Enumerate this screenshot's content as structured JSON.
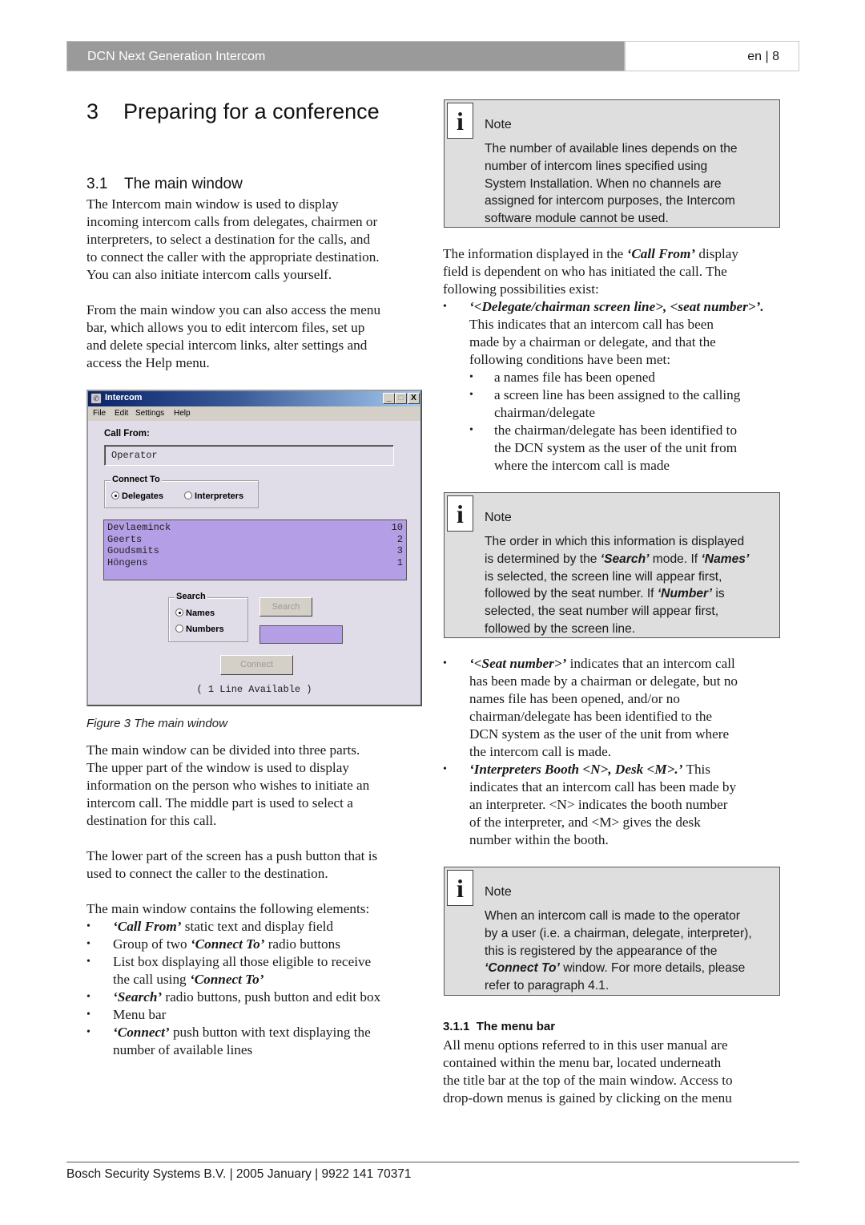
{
  "header": {
    "title": "DCN Next Generation Intercom",
    "page_ref": "en | 8"
  },
  "chapter": {
    "number": "3",
    "title": "Preparing for a conference"
  },
  "section": {
    "number": "3.1",
    "title": "The main window"
  },
  "left": {
    "intro_lines": [
      "The Intercom main window is used to display",
      "incoming intercom calls from delegates, chairmen or",
      "interpreters, to select a destination for the calls, and",
      "to connect the caller with the appropriate destination.",
      "You can also initiate intercom calls yourself."
    ],
    "menu_lines": [
      "From the main window you can also access the menu",
      "bar, which allows you to edit intercom files, set up",
      "and delete special intercom links, alter settings and",
      "access the Help menu."
    ],
    "figure_caption": "Figure 3 The main window",
    "parts_lines": [
      "The main window can be divided into three parts.",
      "The upper part of the window is used to display",
      "information on the person who wishes to initiate an",
      "intercom call. The middle part is used to select a",
      "destination for this call."
    ],
    "lower_lines": [
      "The lower part of the screen has a push button that is",
      "used to connect the caller to the destination."
    ],
    "elements_intro": "The main window contains the following elements:",
    "elements": [
      {
        "em": "‘Call From’",
        "text": " static text and display field"
      },
      {
        "pre": "Group of two ",
        "em": "‘Connect To’",
        "text": " radio buttons"
      },
      {
        "line1": "List box displaying all those eligible to receive",
        "pre": "the call using ",
        "em": "‘Connect To’"
      },
      {
        "em": "‘Search’",
        "text": " radio buttons, push button and edit box"
      },
      {
        "pre": "Menu bar"
      },
      {
        "em": "‘Connect’",
        "text": " push button with text displaying the",
        "line2": "number of available lines"
      }
    ]
  },
  "window": {
    "title": "Intercom",
    "app_icon": "intercom-app-icon",
    "controls": {
      "minimize": "_",
      "maximize": "□",
      "close": "X"
    },
    "menu": [
      "File",
      "Edit",
      "Settings",
      "Help"
    ],
    "call_from_label": "Call From:",
    "call_from_value": "Operator",
    "connect_to": {
      "label": "Connect To",
      "options": [
        {
          "label": "Delegates",
          "selected": true
        },
        {
          "label": "Interpreters",
          "selected": false
        }
      ]
    },
    "list": [
      {
        "name": "Devlaeminck",
        "seat": "10"
      },
      {
        "name": "Geerts",
        "seat": "2"
      },
      {
        "name": "Goudsmits",
        "seat": "3"
      },
      {
        "name": "Höngens",
        "seat": "1"
      }
    ],
    "search": {
      "label": "Search",
      "options": [
        {
          "label": "Names",
          "selected": true
        },
        {
          "label": "Numbers",
          "selected": false
        }
      ],
      "button": "Search",
      "edit_value": ""
    },
    "connect_button": "Connect",
    "status": "( 1 Line Available )"
  },
  "right": {
    "note1": {
      "title": "Note",
      "lines": [
        "The number of available lines depends on the",
        "number of intercom lines specified using",
        "System Installation. When no channels are",
        "assigned for intercom purposes, the Intercom",
        "software module cannot be used."
      ]
    },
    "info_lines": [
      {
        "pre": "The information displayed in the ",
        "em": "‘Call From’",
        "post": " display"
      },
      {
        "pre": "field is dependent on who has initiated the call. The"
      },
      {
        "pre": "following possibilities exist:"
      }
    ],
    "possibility1": {
      "em": "‘<Delegate/chairman screen line>, <seat number>’.",
      "lines": [
        "This indicates that an intercom call has been",
        "made by a chairman or delegate, and that the",
        "following conditions have been met:"
      ],
      "conditions": [
        [
          "a names file has been opened"
        ],
        [
          "a screen line has been assigned to the calling",
          "chairman/delegate"
        ],
        [
          "the chairman/delegate has been identified to",
          "the DCN system as the user of the unit from",
          "where the intercom call is made"
        ]
      ]
    },
    "note2": {
      "title": "Note",
      "lines": [
        [
          {
            "t": "The order in which this information is displayed"
          }
        ],
        [
          {
            "t": "is determined by the "
          },
          {
            "em": "‘Search’"
          },
          {
            "t": " mode. If "
          },
          {
            "em": "‘Names’"
          }
        ],
        [
          {
            "t": "is selected, the screen line will appear first,"
          }
        ],
        [
          {
            "t": "followed by the seat number. If "
          },
          {
            "em": "‘Number’"
          },
          {
            "t": " is"
          }
        ],
        [
          {
            "t": "selected, the seat number will appear first,"
          }
        ],
        [
          {
            "t": "followed by the screen line."
          }
        ]
      ]
    },
    "possibility2": {
      "em": "‘<Seat number>’",
      "first_rest": " indicates that an intercom call",
      "lines": [
        "has been made by a chairman or delegate, but no",
        "names file has been opened, and/or no",
        "chairman/delegate has been identified to the",
        "DCN system as the user of the unit from where",
        "the intercom call is made."
      ]
    },
    "possibility3": {
      "em": "‘Interpreters Booth <N>, Desk <M>.’",
      "first_rest": " This",
      "lines": [
        "indicates that an intercom call has been made by",
        "an interpreter. <N> indicates the booth number",
        "of the interpreter, and <M> gives the desk",
        "number within the booth."
      ]
    },
    "note3": {
      "title": "Note",
      "lines": [
        [
          {
            "t": "When an intercom call is made to the operator"
          }
        ],
        [
          {
            "t": "by a user (i.e. a chairman, delegate, interpreter),"
          }
        ],
        [
          {
            "t": "this is registered by the appearance of the"
          }
        ],
        [
          {
            "em": "‘Connect To’"
          },
          {
            "t": " window. For more details, please"
          }
        ],
        [
          {
            "t": "refer to paragraph 4.1."
          }
        ]
      ]
    },
    "subsection": {
      "number": "3.1.1",
      "title": "The menu bar"
    },
    "menu_bar_lines": [
      "All menu options referred to in this user manual are",
      "contained within the menu bar, located underneath",
      "the title bar at the top of the main window. Access to",
      "drop-down menus is gained by clicking on the menu"
    ]
  },
  "footer": {
    "text": "Bosch Security Systems B.V. | 2005 January | 9922 141 70371"
  },
  "colors": {
    "header_band": "#9a9a9a",
    "note_bg": "#dedede",
    "window_bg": "#e0dce8",
    "list_bg": "#b49ee6",
    "titlebar_start": "#0a246a",
    "titlebar_end": "#a6caf0"
  }
}
